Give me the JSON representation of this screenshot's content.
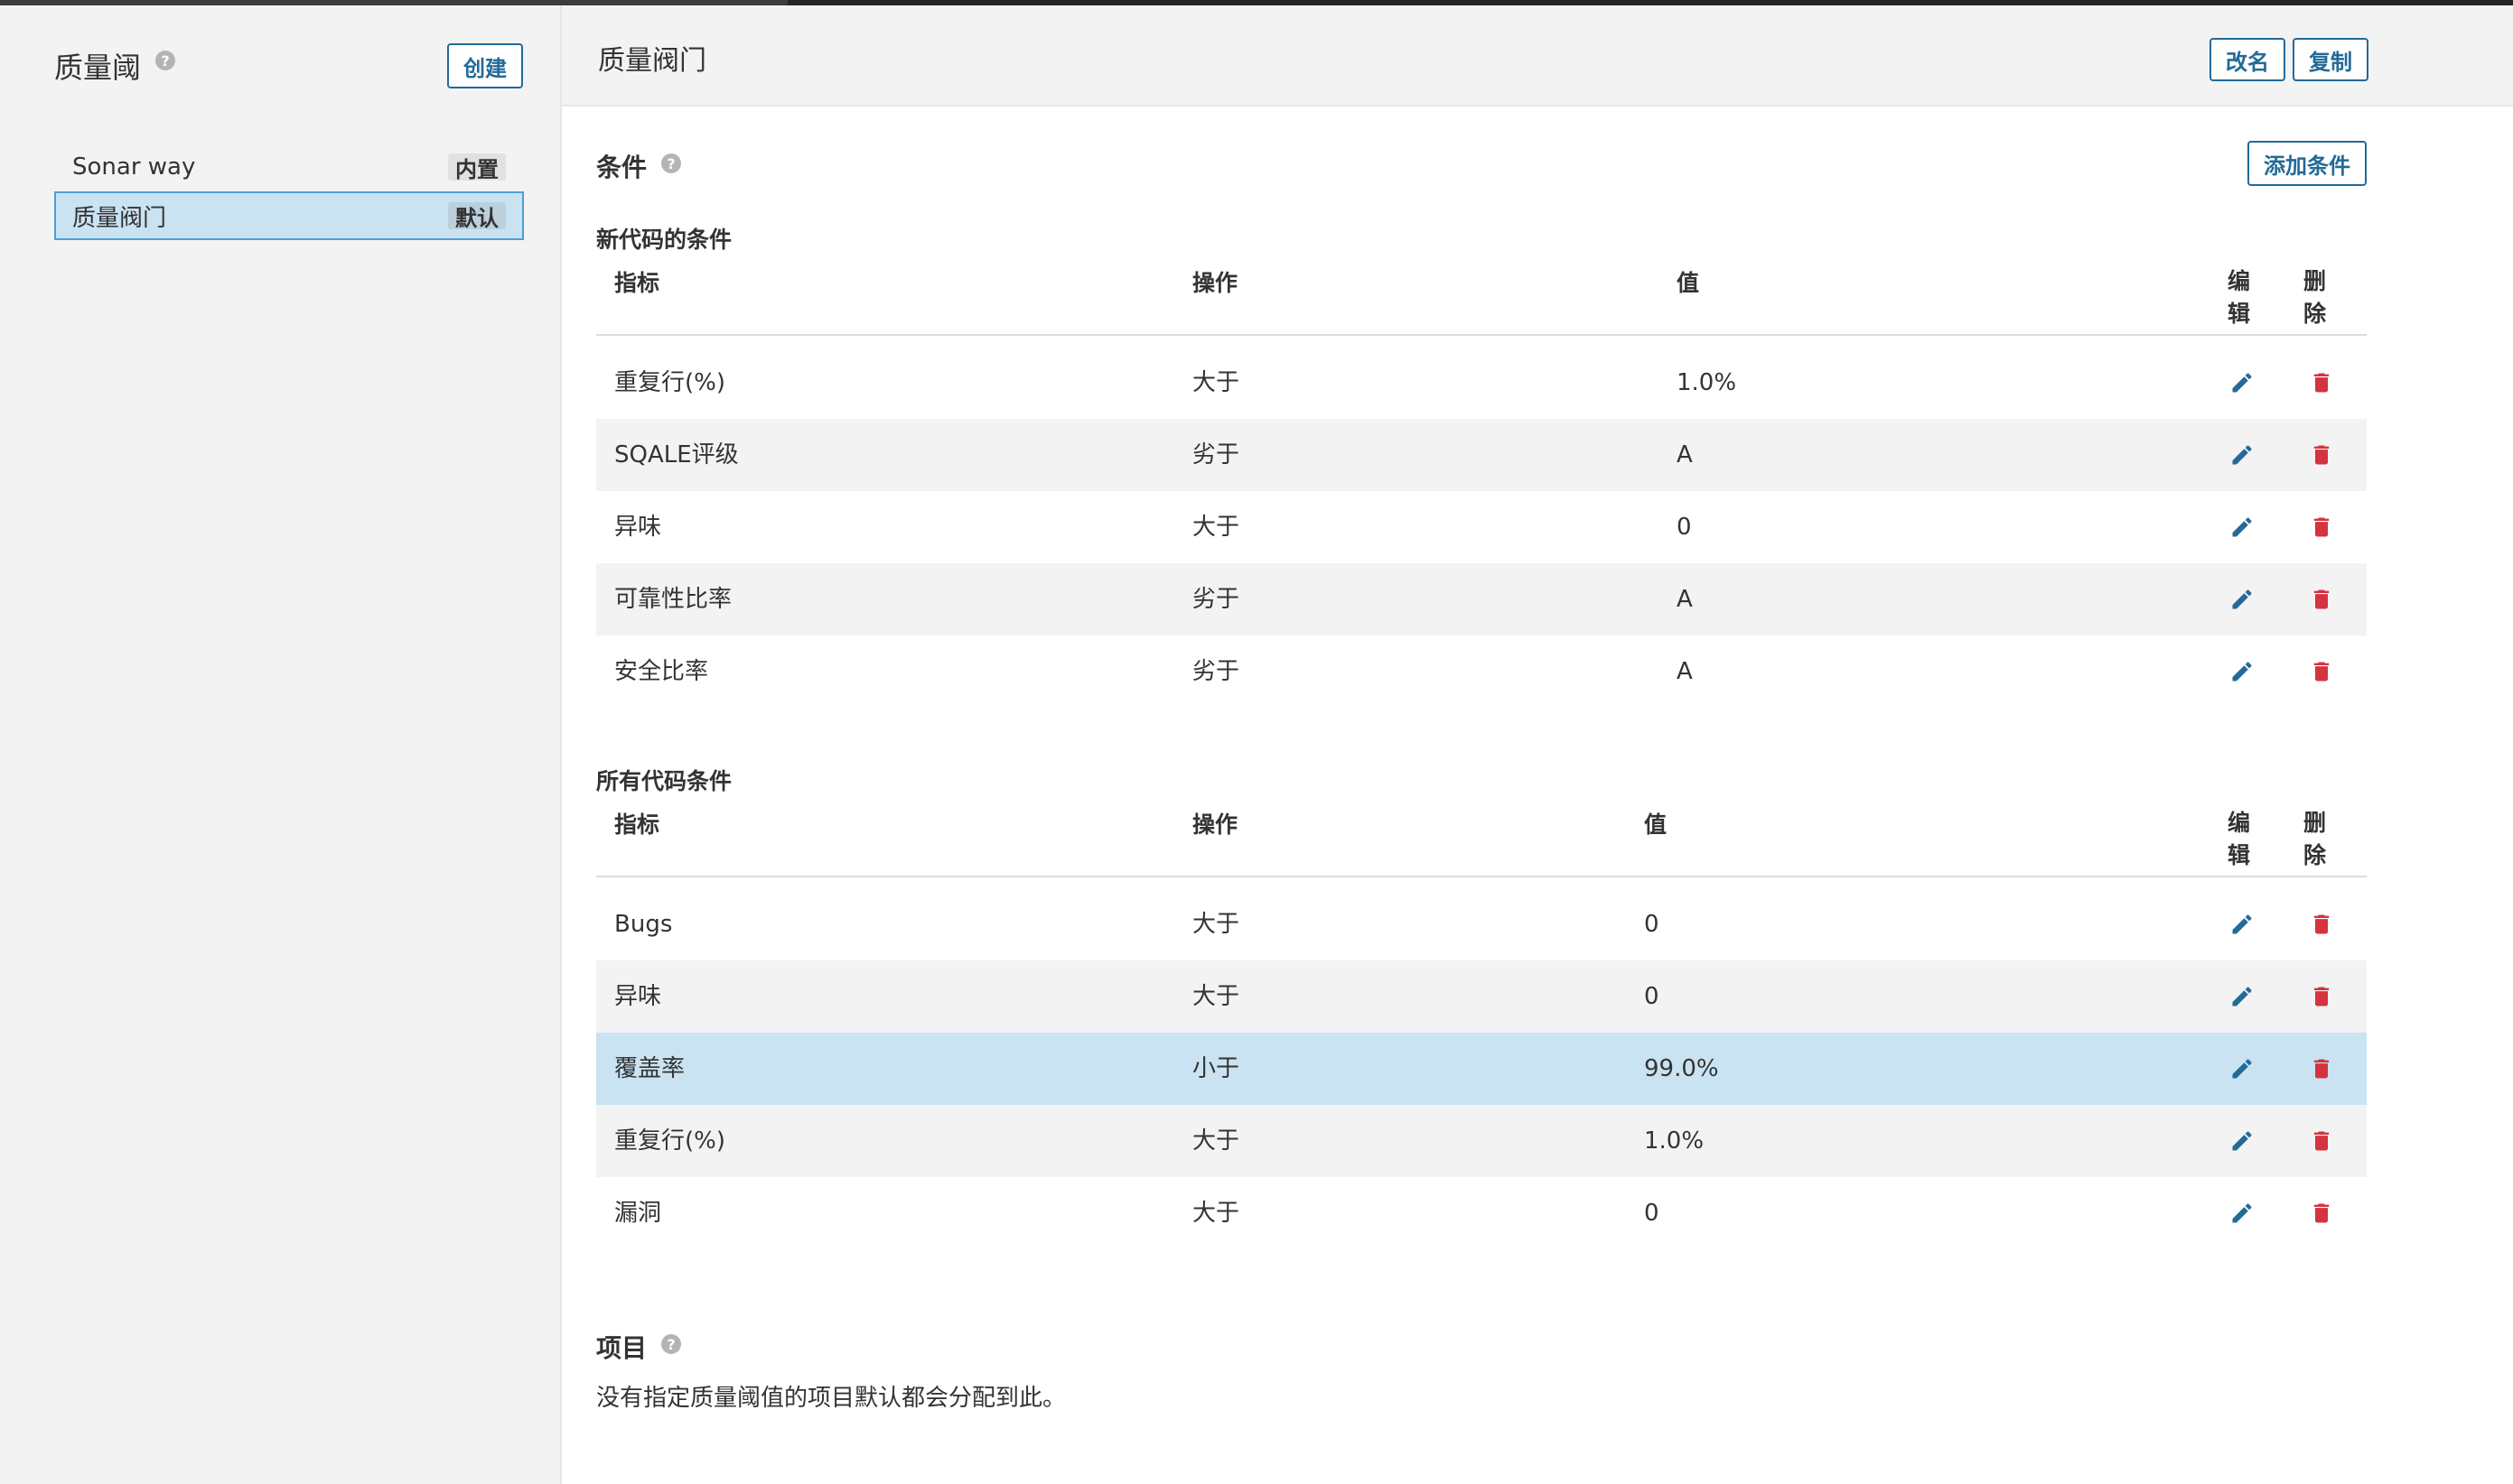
{
  "sidebar": {
    "title": "质量阈",
    "help_glyph": "?",
    "create_label": "创建",
    "items": [
      {
        "name": "Sonar way",
        "badge": "内置"
      },
      {
        "name": "质量阀门",
        "badge": "默认"
      }
    ]
  },
  "header": {
    "title": "质量阀门",
    "rename_label": "改名",
    "copy_label": "复制"
  },
  "conditions": {
    "title": "条件",
    "add_label": "添加条件",
    "columns": {
      "metric": "指标",
      "op": "操作",
      "value": "值",
      "edit_1": "编",
      "edit_2": "辑",
      "delete_1": "删",
      "delete_2": "除"
    },
    "new_code": {
      "title": "新代码的条件",
      "rows": [
        {
          "metric": "重复行(%)",
          "op": "大于",
          "value": "1.0%"
        },
        {
          "metric": "SQALE评级",
          "op": "劣于",
          "value": "A"
        },
        {
          "metric": "异味",
          "op": "大于",
          "value": "0"
        },
        {
          "metric": "可靠性比率",
          "op": "劣于",
          "value": "A"
        },
        {
          "metric": "安全比率",
          "op": "劣于",
          "value": "A"
        }
      ]
    },
    "all_code": {
      "title": "所有代码条件",
      "rows": [
        {
          "metric": "Bugs",
          "op": "大于",
          "value": "0"
        },
        {
          "metric": "异味",
          "op": "大于",
          "value": "0"
        },
        {
          "metric": "覆盖率",
          "op": "小于",
          "value": "99.0%"
        },
        {
          "metric": "重复行(%)",
          "op": "大于",
          "value": "1.0%"
        },
        {
          "metric": "漏洞",
          "op": "大于",
          "value": "0"
        }
      ]
    }
  },
  "projects": {
    "title": "项目",
    "description": "没有指定质量阈值的项目默认都会分配到此。"
  },
  "colors": {
    "accent": "#236a97",
    "selected_bg": "#cae3f2",
    "delete": "#d4333f"
  },
  "icons": {
    "edit": "pencil-icon",
    "delete": "trash-icon",
    "help": "question-circle-icon"
  }
}
